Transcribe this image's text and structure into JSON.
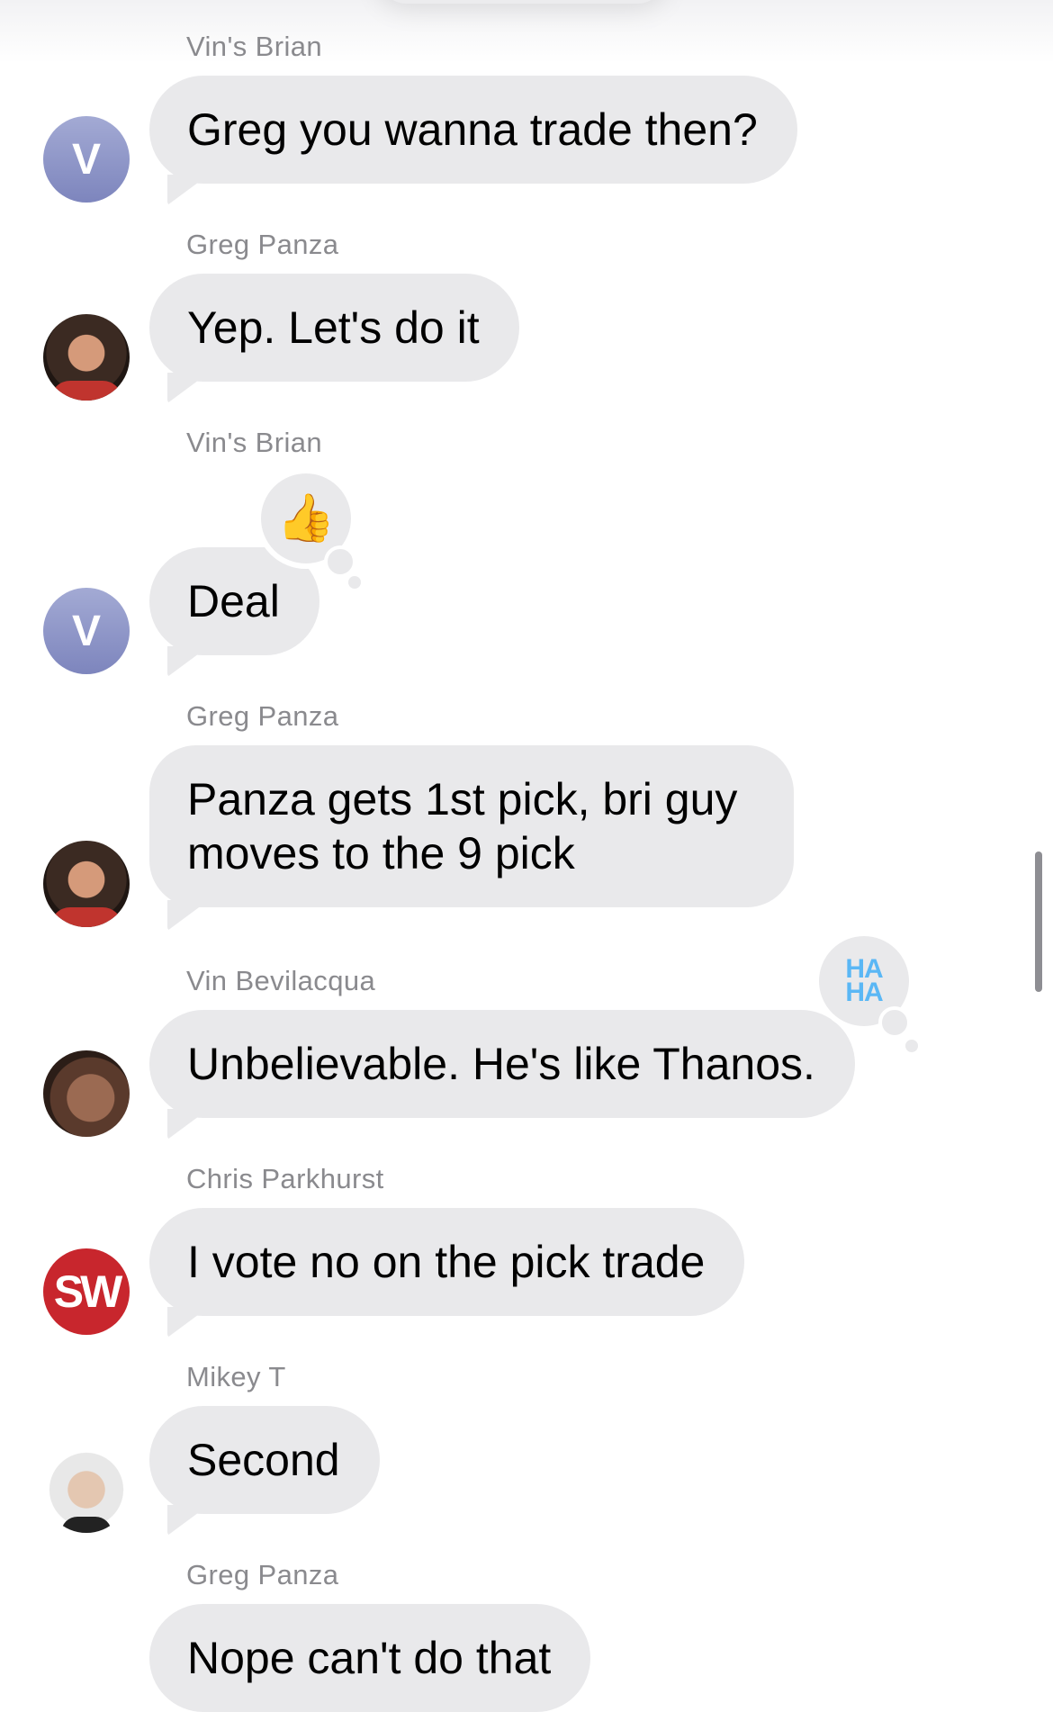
{
  "messages": [
    {
      "sender": "Vin's Brian",
      "text": "Greg you wanna trade then?",
      "avatar": "V"
    },
    {
      "sender": "Greg Panza",
      "text": "Yep. Let's do it"
    },
    {
      "sender": "Vin's Brian",
      "text": "Deal",
      "avatar": "V",
      "reaction": "thumbs-up"
    },
    {
      "sender": "Greg Panza",
      "text": "Panza gets 1st pick, bri guy moves to the 9 pick"
    },
    {
      "sender": "Vin Bevilacqua",
      "text": "Unbelievable. He's like Thanos.",
      "reaction": "HA HA"
    },
    {
      "sender": "Chris Parkhurst",
      "text": "I vote no on the pick trade",
      "avatar": "SW"
    },
    {
      "sender": "Mikey T",
      "text": "Second"
    },
    {
      "sender": "Greg Panza",
      "text": "Nope can't do that"
    }
  ],
  "reactions": {
    "thumb_glyph": "👍",
    "haha_line1": "HA",
    "haha_line2": "HA"
  },
  "colors": {
    "bubble": "#e9e9eb",
    "sender": "#8a8a8e",
    "avatar_v": "#8f97c9",
    "sw_red": "#c8262d",
    "haha_blue": "#5ab7f5"
  }
}
